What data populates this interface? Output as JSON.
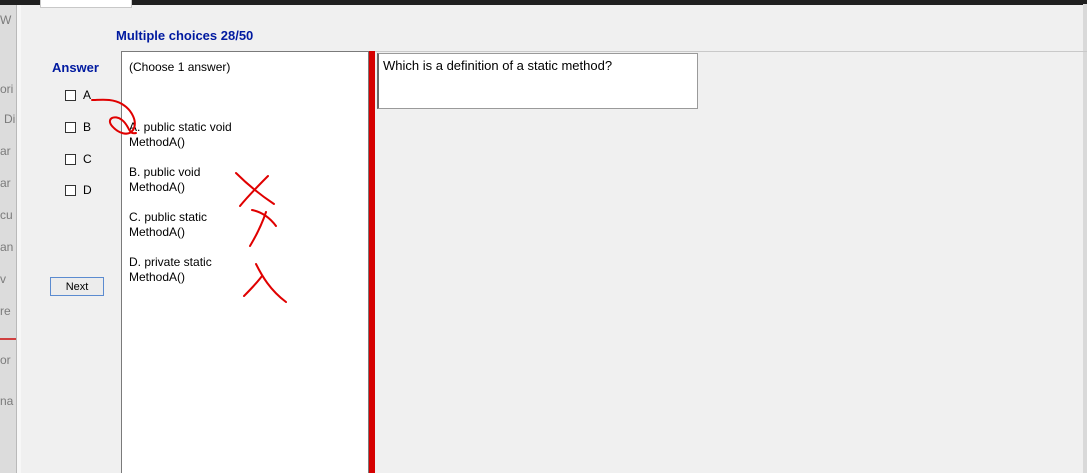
{
  "window": {
    "back_fragments": [
      "W",
      "ori",
      "Di",
      "ar",
      "ar",
      "cu",
      "an",
      "v",
      "re",
      "or",
      "na"
    ]
  },
  "header": {
    "title": "Multiple choices 28/50"
  },
  "answer": {
    "label": "Answer",
    "options": [
      "A",
      "B",
      "C",
      "D"
    ]
  },
  "next_button": {
    "label": "Next"
  },
  "choices": {
    "hint": "(Choose 1 answer)",
    "items": [
      {
        "letter": "A.",
        "text": "A.  public static void MethodA()"
      },
      {
        "letter": "B.",
        "text": "B.  public void MethodA()"
      },
      {
        "letter": "C.",
        "text": "C.  public static MethodA()"
      },
      {
        "letter": "D.",
        "text": "D.  private static MethodA()"
      }
    ]
  },
  "question": {
    "text": "Which is a definition of a static method?"
  },
  "colors": {
    "accent_title": "#001aa0",
    "splitter": "#d60000",
    "annotation_ink": "#e00000"
  }
}
